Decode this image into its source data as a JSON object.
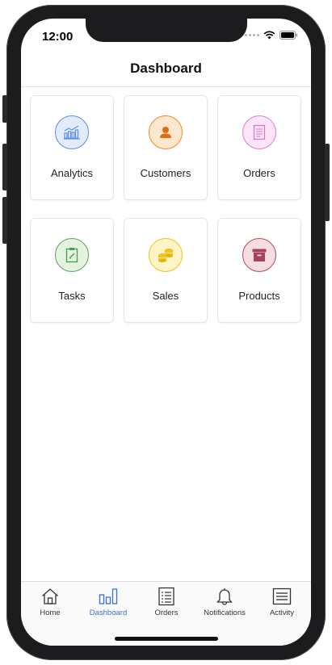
{
  "status_bar": {
    "time": "12:00"
  },
  "header": {
    "title": "Dashboard"
  },
  "tiles": [
    {
      "label": "Analytics",
      "icon": "chart-icon",
      "accent": "#5b8def",
      "fill": "#e3ecfd"
    },
    {
      "label": "Customers",
      "icon": "user-icon",
      "accent": "#f08a24",
      "fill": "#fde8cf"
    },
    {
      "label": "Orders",
      "icon": "document-icon",
      "accent": "#e07ad8",
      "fill": "#fbe6f8"
    },
    {
      "label": "Tasks",
      "icon": "clipboard-icon",
      "accent": "#5aa85a",
      "fill": "#e3f3e0"
    },
    {
      "label": "Sales",
      "icon": "coins-icon",
      "accent": "#f2c418",
      "fill": "#fff3c8"
    },
    {
      "label": "Products",
      "icon": "box-icon",
      "accent": "#b2495e",
      "fill": "#f5dde2"
    }
  ],
  "tab_bar": {
    "active_color": "#3a6fd8",
    "items": [
      {
        "label": "Home",
        "icon": "home-icon",
        "active": false
      },
      {
        "label": "Dashboard",
        "icon": "bar-chart-icon",
        "active": true
      },
      {
        "label": "Orders",
        "icon": "list-icon",
        "active": false
      },
      {
        "label": "Notifications",
        "icon": "bell-icon",
        "active": false
      },
      {
        "label": "Activity",
        "icon": "menu-icon",
        "active": false
      }
    ]
  }
}
